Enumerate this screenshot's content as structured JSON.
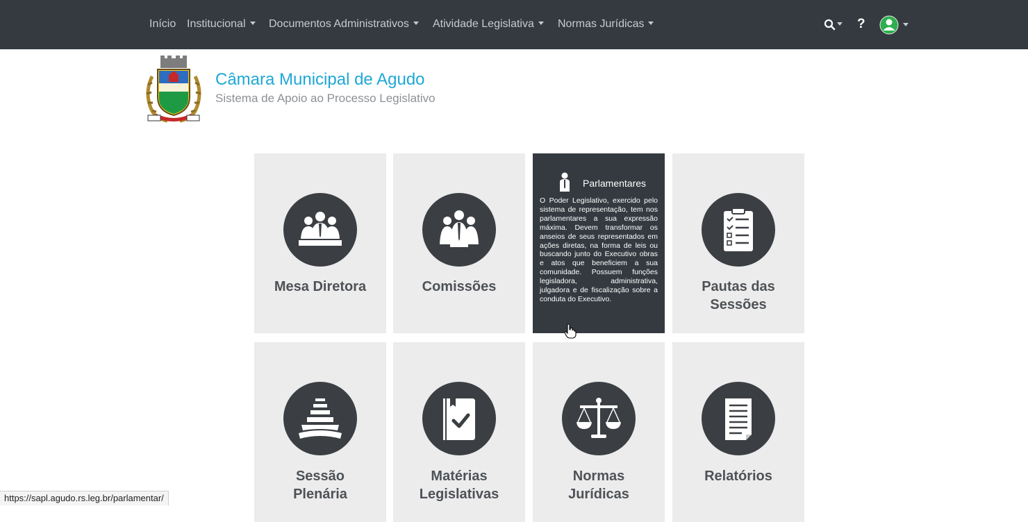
{
  "nav": {
    "items": [
      {
        "label": "Início",
        "dropdown": false
      },
      {
        "label": "Institucional",
        "dropdown": true
      },
      {
        "label": "Documentos Administrativos",
        "dropdown": true
      },
      {
        "label": "Atividade Legislativa",
        "dropdown": true
      },
      {
        "label": "Normas Jurídicas",
        "dropdown": true
      }
    ],
    "help_label": "?",
    "icons": [
      "search-icon",
      "help-icon",
      "user-avatar-icon"
    ]
  },
  "header": {
    "title": "Câmara Municipal de Agudo",
    "subtitle": "Sistema de Apoio ao Processo Legislativo"
  },
  "tiles": [
    {
      "label_lines": [
        "Mesa Diretora"
      ],
      "icon": "mesa-diretora-icon"
    },
    {
      "label_lines": [
        "Comissões"
      ],
      "icon": "comissoes-icon"
    },
    {
      "title": "Parlamentares",
      "icon": "parlamentar-icon",
      "active": true,
      "description": "O Poder Legislativo, exercido pelo sistema de representação, tem nos parlamentares a sua expressão máxima. Devem transformar os anseios de seus representados em ações diretas, na forma de leis ou buscando junto do Executivo obras e atos que beneficiem a sua comunidade. Possuem funções legisladora, administrativa, julgadora e de fiscalização sobre a conduta do Executivo."
    },
    {
      "label_lines": [
        "Pautas das",
        "Sessões"
      ],
      "icon": "clipboard-icon"
    },
    {
      "label_lines": [
        "Sessão",
        "Plenária"
      ],
      "icon": "plenario-icon"
    },
    {
      "label_lines": [
        "Matérias",
        "Legislativas"
      ],
      "icon": "book-check-icon"
    },
    {
      "label_lines": [
        "Normas",
        "Jurídicas"
      ],
      "icon": "scales-icon"
    },
    {
      "label_lines": [
        "Relatórios"
      ],
      "icon": "report-icon"
    }
  ],
  "statusbar": {
    "url": "https://sapl.agudo.rs.leg.br/parlamentar/"
  },
  "colors": {
    "navbar": "#343a40",
    "title": "#1fa7d6",
    "tile_bg": "#ececec",
    "circle": "#3b3f43"
  }
}
